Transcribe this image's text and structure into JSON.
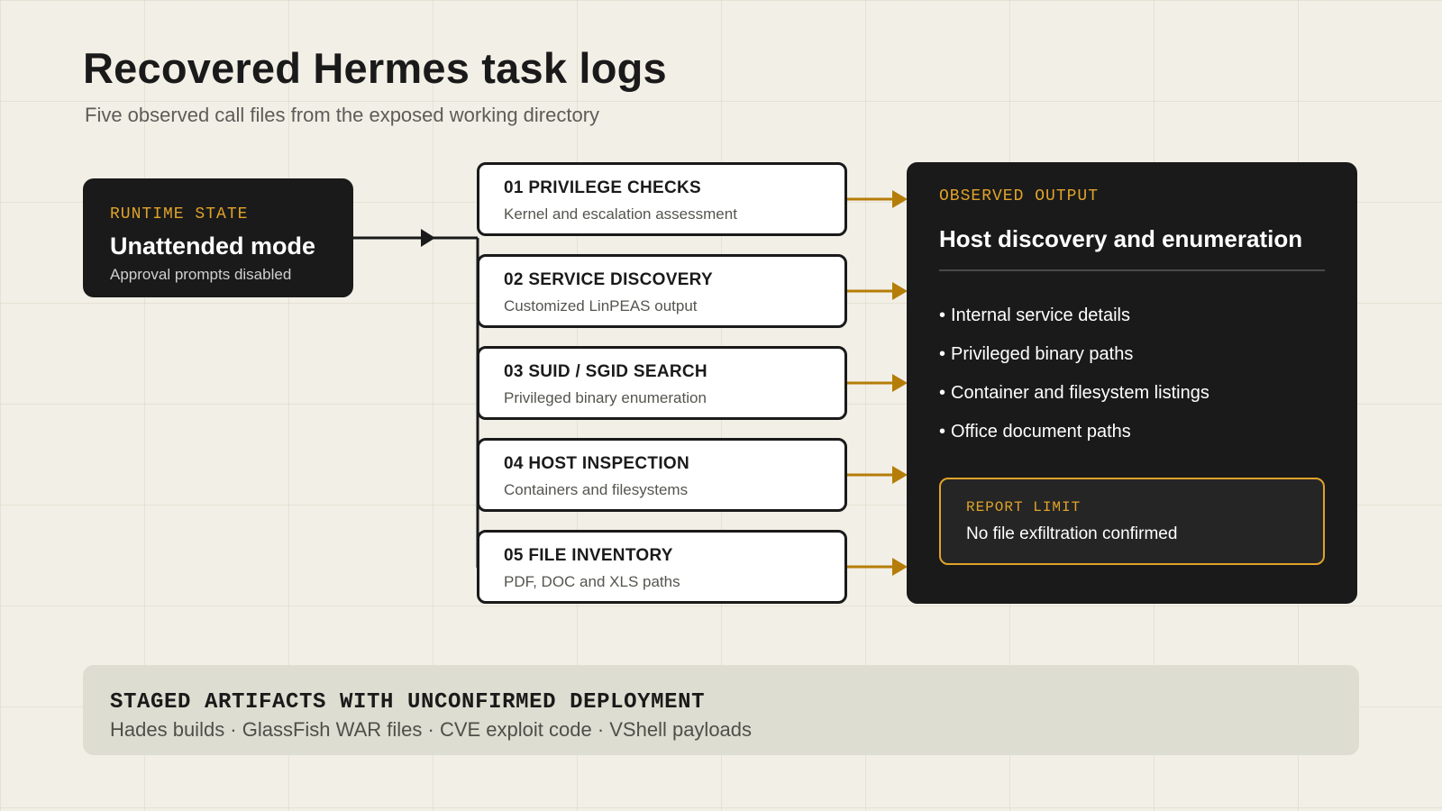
{
  "header": {
    "title": "Recovered Hermes task logs",
    "subtitle": "Five observed call files from the exposed working directory"
  },
  "runtime": {
    "eyebrow": "RUNTIME STATE",
    "heading": "Unattended mode",
    "note": "Approval prompts disabled"
  },
  "steps": [
    {
      "title": "01 PRIVILEGE CHECKS",
      "desc": "Kernel and escalation assessment"
    },
    {
      "title": "02 SERVICE DISCOVERY",
      "desc": "Customized LinPEAS output"
    },
    {
      "title": "03 SUID / SGID SEARCH",
      "desc": "Privileged binary enumeration"
    },
    {
      "title": "04 HOST INSPECTION",
      "desc": "Containers and filesystems"
    },
    {
      "title": "05 FILE INVENTORY",
      "desc": "PDF, DOC and XLS paths"
    }
  ],
  "output": {
    "eyebrow": "OBSERVED OUTPUT",
    "heading": "Host discovery and enumeration",
    "bullet_glyph": "•",
    "items": [
      "Internal service details",
      "Privileged binary paths",
      "Container and filesystem listings",
      "Office document paths"
    ],
    "limit": {
      "eyebrow": "REPORT LIMIT",
      "text": "No file exfiltration confirmed"
    }
  },
  "staged": {
    "title": "STAGED ARTIFACTS WITH UNCONFIRMED DEPLOYMENT",
    "items": "Hades builds · GlassFish WAR files · CVE exploit code · VShell payloads"
  },
  "colors": {
    "background": "#f2efe6",
    "dark_panel": "#1a1a1a",
    "accent": "#e0a32a",
    "arrow": "#b57d08",
    "staged_panel": "#deddd1"
  }
}
